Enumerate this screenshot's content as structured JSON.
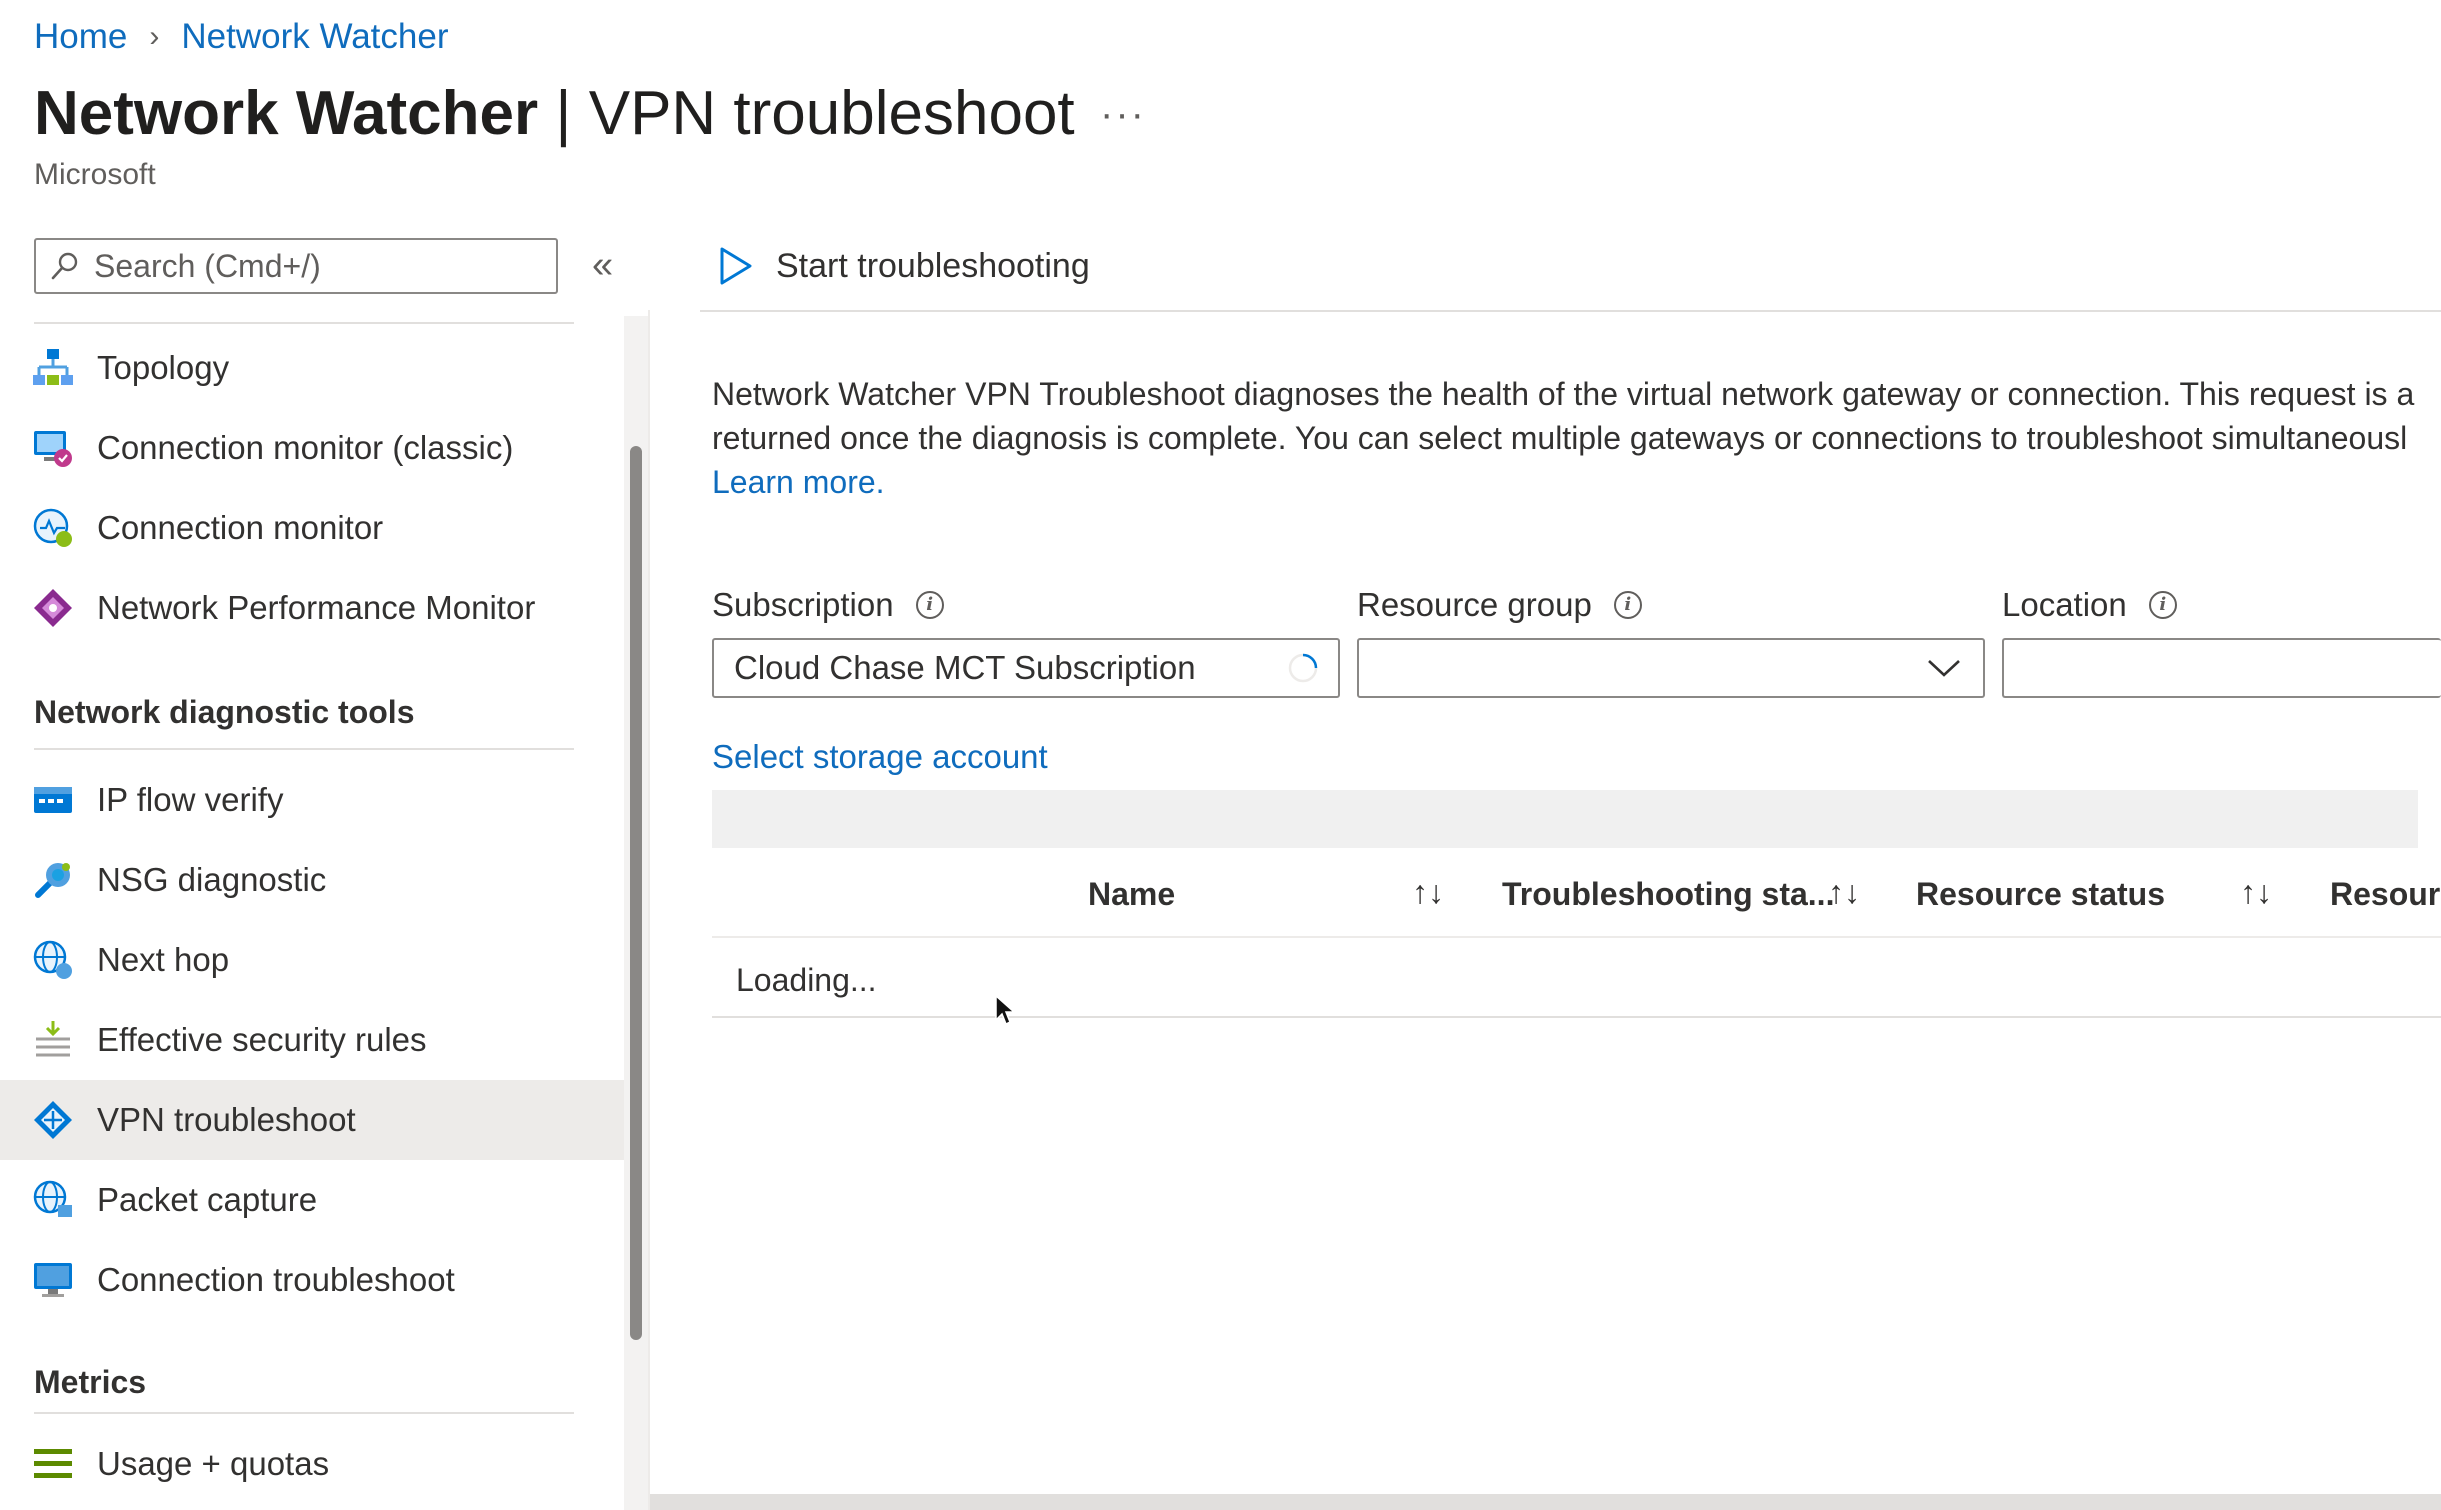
{
  "breadcrumb": {
    "home": "Home",
    "current": "Network Watcher",
    "separator": "›"
  },
  "header": {
    "title_bold": "Network Watcher",
    "title_rest": " | VPN troubleshoot",
    "more": "···",
    "subtitle": "Microsoft"
  },
  "search": {
    "placeholder": "Search (Cmd+/)",
    "collapse": "«"
  },
  "sidebar": {
    "items": [
      {
        "label": "Topology",
        "icon": "topology-icon"
      },
      {
        "label": "Connection monitor (classic)",
        "icon": "connection-monitor-classic-icon"
      },
      {
        "label": "Connection monitor",
        "icon": "connection-monitor-icon"
      },
      {
        "label": "Network Performance Monitor",
        "icon": "network-performance-monitor-icon"
      }
    ],
    "section_tools": "Network diagnostic tools",
    "tools": [
      {
        "label": "IP flow verify",
        "icon": "ip-flow-verify-icon"
      },
      {
        "label": "NSG diagnostic",
        "icon": "nsg-diagnostic-icon"
      },
      {
        "label": "Next hop",
        "icon": "next-hop-icon"
      },
      {
        "label": "Effective security rules",
        "icon": "effective-security-rules-icon"
      },
      {
        "label": "VPN troubleshoot",
        "icon": "vpn-troubleshoot-icon",
        "selected": true
      },
      {
        "label": "Packet capture",
        "icon": "packet-capture-icon"
      },
      {
        "label": "Connection troubleshoot",
        "icon": "connection-troubleshoot-icon"
      }
    ],
    "section_metrics": "Metrics",
    "metrics": [
      {
        "label": "Usage + quotas",
        "icon": "usage-quotas-icon"
      }
    ]
  },
  "toolbar": {
    "start_label": "Start troubleshooting"
  },
  "description": {
    "line1": "Network Watcher VPN Troubleshoot diagnoses the health of the virtual network gateway or connection. This request is a",
    "line2": "returned once the diagnosis is complete. You can select multiple gateways or connections to troubleshoot simultaneousl",
    "learn_more": "Learn more."
  },
  "filters": {
    "subscription_label": "Subscription",
    "subscription_value": "Cloud Chase MCT Subscription",
    "resource_group_label": "Resource group",
    "resource_group_value": "",
    "location_label": "Location",
    "location_value": ""
  },
  "storage": {
    "link": "Select storage account"
  },
  "table": {
    "columns": [
      "Name",
      "Troubleshooting sta...",
      "Resource status",
      "Resourc"
    ],
    "sort_glyph": "↑↓",
    "loading": "Loading..."
  },
  "colors": {
    "accent": "#0f6cbd",
    "selected_bg": "#edebe9",
    "text": "#323130"
  }
}
